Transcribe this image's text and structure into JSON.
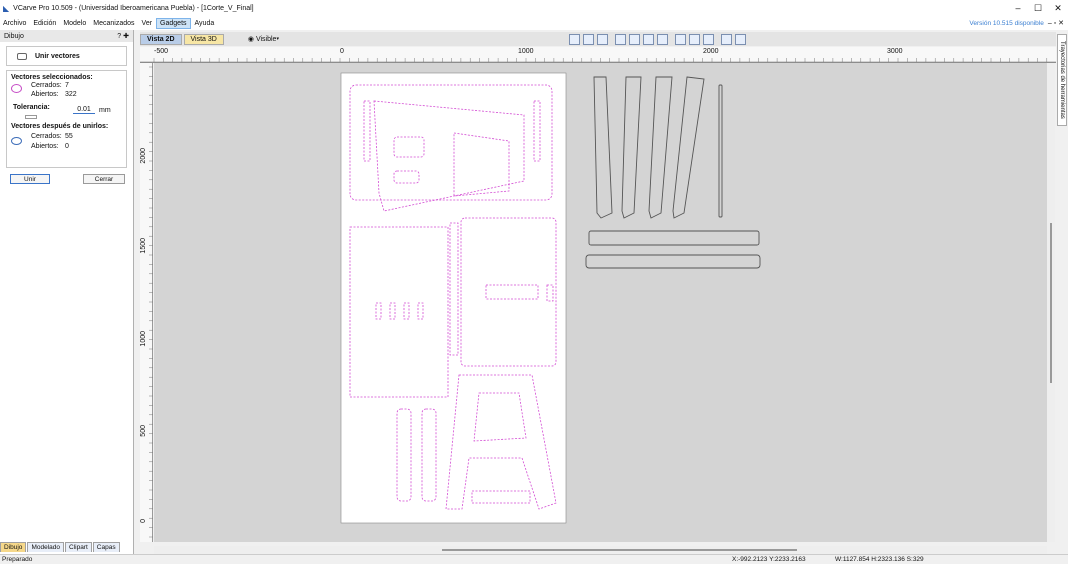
{
  "window": {
    "title": "VCarve Pro 10.509 - (Universidad Iberoamericana Puebla) - [1Corte_V_Final]",
    "minimize_icon": "minimize-icon",
    "maximize_icon": "maximize-icon",
    "close_icon": "close-icon"
  },
  "menu": {
    "items": [
      "Archivo",
      "Edición",
      "Modelo",
      "Mecanizados",
      "Ver",
      "Gadgets",
      "Ayuda"
    ],
    "active": "Gadgets",
    "version_notice": "Versión 10.515 disponible"
  },
  "panel": {
    "title": "Dibujo",
    "header_icons": "? ✚",
    "tool_name": "Unir vectores",
    "selected_heading": "Vectores seleccionados:",
    "closed_label": "Cerrados:",
    "closed_value": "7",
    "open_label": "Abiertos:",
    "open_value": "322",
    "tolerance_label": "Tolerancia:",
    "tolerance_value": "0.01",
    "tolerance_unit": "mm",
    "after_heading": "Vectores después de unirlos:",
    "after_closed_label": "Cerrados:",
    "after_closed_value": "55",
    "after_open_label": "Abiertos:",
    "after_open_value": "0",
    "join_button": "Unir",
    "close_button": "Cerrar"
  },
  "bottom_tabs": [
    "Dibujo",
    "Modelado",
    "Clipart",
    "Capas"
  ],
  "views": {
    "tab_2d": "Vista 2D",
    "tab_3d": "Vista 3D",
    "visible_label": "Visible"
  },
  "ruler": {
    "h_ticks": [
      "-500",
      "0",
      "1000",
      "2000",
      "3000"
    ],
    "v_ticks": [
      "2000",
      "1500",
      "1000",
      "500",
      "0"
    ]
  },
  "right_tab": "Trayectorias de herramientas",
  "status": {
    "left": "Preparado",
    "coords": "X:-992.2123 Y:2233.2163",
    "dims": "W:1127.854  H:2323.136  S:329"
  },
  "colors": {
    "magenta": "#d34bd3",
    "shape": "#555555",
    "sheet": "#ffffff"
  }
}
